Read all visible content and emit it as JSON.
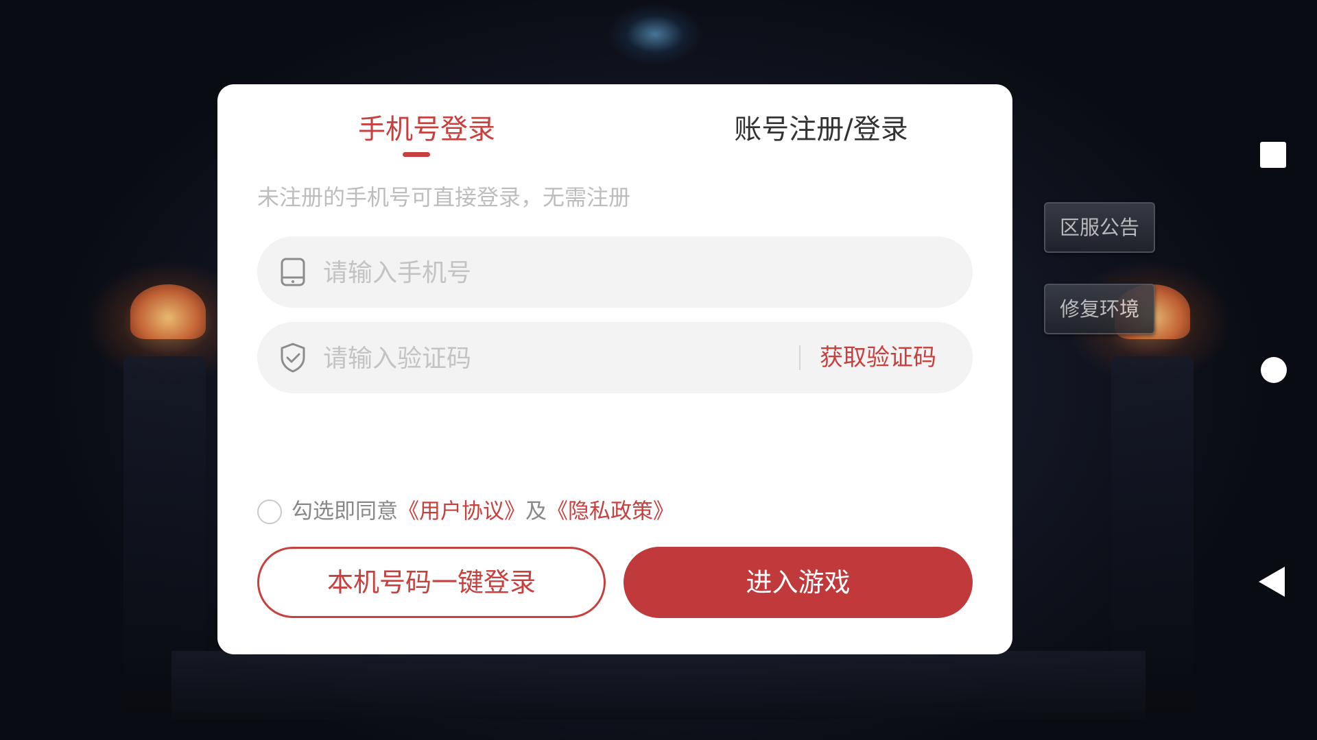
{
  "tabs": {
    "phone_login": "手机号登录",
    "account_login": "账号注册/登录"
  },
  "hint": "未注册的手机号可直接登录，无需注册",
  "phone_field": {
    "icon": "phone-icon",
    "placeholder": "请输入手机号",
    "value": ""
  },
  "code_field": {
    "icon": "shield-check-icon",
    "placeholder": "请输入验证码",
    "value": "",
    "get_code": "获取验证码"
  },
  "agreement": {
    "checked": false,
    "prefix": "勾选即同意",
    "user_agreement": "《用户协议》",
    "and": "及",
    "privacy_policy": "《隐私政策》"
  },
  "buttons": {
    "one_key_login": "本机号码一键登录",
    "enter_game": "进入游戏"
  },
  "side_buttons": {
    "notice": "区服公告",
    "repair": "修复环境"
  },
  "nav": {
    "recent": "square-icon",
    "home": "circle-icon",
    "back": "back-triangle-icon"
  },
  "colors": {
    "accent": "#c8403e",
    "primary_button": "#c0393b",
    "field_bg": "#f3f3f3"
  }
}
